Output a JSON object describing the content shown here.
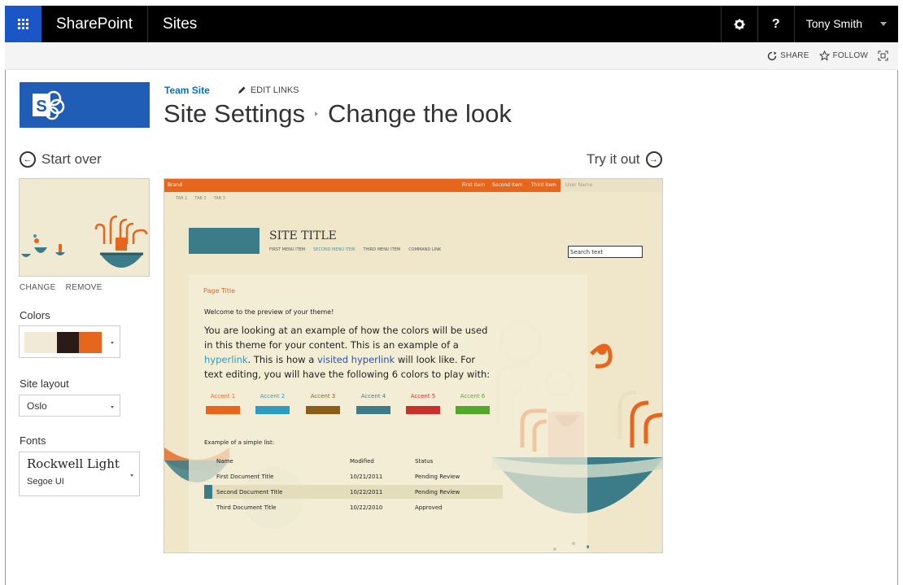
{
  "suitebar": {
    "brand": "SharePoint",
    "section": "Sites",
    "help_label": "?",
    "user_name": "Tony Smith"
  },
  "actions": {
    "share": "SHARE",
    "follow": "FOLLOW"
  },
  "header": {
    "team_site": "Team Site",
    "edit_links": "EDIT LINKS",
    "title_part1": "Site Settings",
    "title_part2": "Change the look"
  },
  "nav": {
    "start_over": "Start over",
    "try_it_out": "Try it out"
  },
  "panel": {
    "change": "CHANGE",
    "remove": "REMOVE",
    "colors_label": "Colors",
    "swatches": [
      "#f0ead6",
      "#2a1a18",
      "#e5661c"
    ],
    "site_layout_label": "Site layout",
    "site_layout_value": "Oslo",
    "fonts_label": "Fonts",
    "font_heading": "Rockwell Light",
    "font_body": "Segoe UI"
  },
  "preview": {
    "brand": "Brand",
    "top_nav": [
      "First Item",
      "Second Item",
      "Third Item"
    ],
    "user_name": "User Name",
    "tabs": [
      "TAB 1",
      "TAB 2",
      "TAB 3"
    ],
    "site_title": "SITE TITLE",
    "menu": [
      "FIRST MENU ITEM",
      "SECOND MENU ITEM",
      "THIRD MENU ITEM",
      "COMMAND LINK"
    ],
    "search_text": "Search text",
    "page_title": "Page Title",
    "welcome": "Welcome to the preview of your theme!",
    "para_1": "You are looking at an example of how the colors will be used in this theme for your content. This is an example of a ",
    "hyperlink": "hyperlink",
    "para_2": ". This is how a ",
    "visited_hyperlink": "visited hyperlink",
    "para_3": " will look like. For text editing, you will have the following 6 colors to play with:",
    "accents": [
      {
        "label": "Accent 1",
        "color": "#e5661c"
      },
      {
        "label": "Accent 2",
        "color": "#2e9bc0"
      },
      {
        "label": "Accent 3",
        "color": "#8a5e1a"
      },
      {
        "label": "Accent 4",
        "color": "#3b7c88"
      },
      {
        "label": "Accent 5",
        "color": "#c8302c"
      },
      {
        "label": "Accent 6",
        "color": "#52a82a"
      }
    ],
    "list_title": "Example of a simple list:",
    "list_headers": [
      "Name",
      "Modified",
      "Status"
    ],
    "list_rows": [
      [
        "First Document Title",
        "10/21/2011",
        "Pending Review"
      ],
      [
        "Second Document Title",
        "10/22/2011",
        "Pending Review"
      ],
      [
        "Third Document Title",
        "10/22/2010",
        "Approved"
      ]
    ]
  }
}
